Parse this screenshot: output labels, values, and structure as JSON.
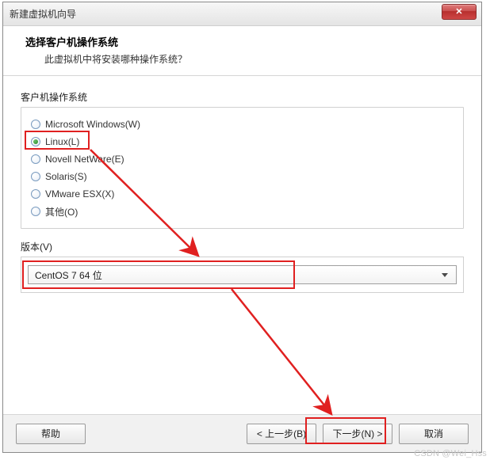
{
  "window": {
    "title": "新建虚拟机向导",
    "close_glyph": "✕"
  },
  "header": {
    "title": "选择客户机操作系统",
    "subtitle": "此虚拟机中将安装哪种操作系统？"
  },
  "os_group": {
    "label": "客户机操作系统",
    "options": [
      {
        "label": "Microsoft Windows(W)",
        "selected": false
      },
      {
        "label": "Linux(L)",
        "selected": true
      },
      {
        "label": "Novell NetWare(E)",
        "selected": false
      },
      {
        "label": "Solaris(S)",
        "selected": false
      },
      {
        "label": "VMware ESX(X)",
        "selected": false
      },
      {
        "label": "其他(O)",
        "selected": false
      }
    ]
  },
  "version": {
    "label": "版本(V)",
    "selected": "CentOS 7 64 位"
  },
  "buttons": {
    "help": "帮助",
    "back": "< 上一步(B)",
    "next": "下一步(N) >",
    "cancel": "取消"
  },
  "annotation": {
    "highlight_color": "#e02020"
  },
  "watermark": "CSDN @Wei_Hss"
}
